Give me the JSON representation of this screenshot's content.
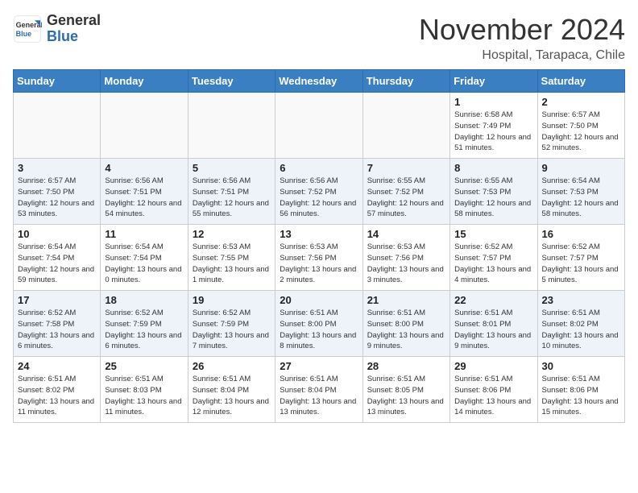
{
  "header": {
    "logo_general": "General",
    "logo_blue": "Blue",
    "month_title": "November 2024",
    "subtitle": "Hospital, Tarapaca, Chile"
  },
  "weekdays": [
    "Sunday",
    "Monday",
    "Tuesday",
    "Wednesday",
    "Thursday",
    "Friday",
    "Saturday"
  ],
  "weeks": [
    [
      {
        "day": "",
        "empty": true
      },
      {
        "day": "",
        "empty": true
      },
      {
        "day": "",
        "empty": true
      },
      {
        "day": "",
        "empty": true
      },
      {
        "day": "",
        "empty": true
      },
      {
        "day": "1",
        "sunrise": "6:58 AM",
        "sunset": "7:49 PM",
        "daylight": "12 hours and 51 minutes."
      },
      {
        "day": "2",
        "sunrise": "6:57 AM",
        "sunset": "7:50 PM",
        "daylight": "12 hours and 52 minutes."
      }
    ],
    [
      {
        "day": "3",
        "sunrise": "6:57 AM",
        "sunset": "7:50 PM",
        "daylight": "12 hours and 53 minutes."
      },
      {
        "day": "4",
        "sunrise": "6:56 AM",
        "sunset": "7:51 PM",
        "daylight": "12 hours and 54 minutes."
      },
      {
        "day": "5",
        "sunrise": "6:56 AM",
        "sunset": "7:51 PM",
        "daylight": "12 hours and 55 minutes."
      },
      {
        "day": "6",
        "sunrise": "6:56 AM",
        "sunset": "7:52 PM",
        "daylight": "12 hours and 56 minutes."
      },
      {
        "day": "7",
        "sunrise": "6:55 AM",
        "sunset": "7:52 PM",
        "daylight": "12 hours and 57 minutes."
      },
      {
        "day": "8",
        "sunrise": "6:55 AM",
        "sunset": "7:53 PM",
        "daylight": "12 hours and 58 minutes."
      },
      {
        "day": "9",
        "sunrise": "6:54 AM",
        "sunset": "7:53 PM",
        "daylight": "12 hours and 58 minutes."
      }
    ],
    [
      {
        "day": "10",
        "sunrise": "6:54 AM",
        "sunset": "7:54 PM",
        "daylight": "12 hours and 59 minutes."
      },
      {
        "day": "11",
        "sunrise": "6:54 AM",
        "sunset": "7:54 PM",
        "daylight": "13 hours and 0 minutes."
      },
      {
        "day": "12",
        "sunrise": "6:53 AM",
        "sunset": "7:55 PM",
        "daylight": "13 hours and 1 minute."
      },
      {
        "day": "13",
        "sunrise": "6:53 AM",
        "sunset": "7:56 PM",
        "daylight": "13 hours and 2 minutes."
      },
      {
        "day": "14",
        "sunrise": "6:53 AM",
        "sunset": "7:56 PM",
        "daylight": "13 hours and 3 minutes."
      },
      {
        "day": "15",
        "sunrise": "6:52 AM",
        "sunset": "7:57 PM",
        "daylight": "13 hours and 4 minutes."
      },
      {
        "day": "16",
        "sunrise": "6:52 AM",
        "sunset": "7:57 PM",
        "daylight": "13 hours and 5 minutes."
      }
    ],
    [
      {
        "day": "17",
        "sunrise": "6:52 AM",
        "sunset": "7:58 PM",
        "daylight": "13 hours and 6 minutes."
      },
      {
        "day": "18",
        "sunrise": "6:52 AM",
        "sunset": "7:59 PM",
        "daylight": "13 hours and 6 minutes."
      },
      {
        "day": "19",
        "sunrise": "6:52 AM",
        "sunset": "7:59 PM",
        "daylight": "13 hours and 7 minutes."
      },
      {
        "day": "20",
        "sunrise": "6:51 AM",
        "sunset": "8:00 PM",
        "daylight": "13 hours and 8 minutes."
      },
      {
        "day": "21",
        "sunrise": "6:51 AM",
        "sunset": "8:00 PM",
        "daylight": "13 hours and 9 minutes."
      },
      {
        "day": "22",
        "sunrise": "6:51 AM",
        "sunset": "8:01 PM",
        "daylight": "13 hours and 9 minutes."
      },
      {
        "day": "23",
        "sunrise": "6:51 AM",
        "sunset": "8:02 PM",
        "daylight": "13 hours and 10 minutes."
      }
    ],
    [
      {
        "day": "24",
        "sunrise": "6:51 AM",
        "sunset": "8:02 PM",
        "daylight": "13 hours and 11 minutes."
      },
      {
        "day": "25",
        "sunrise": "6:51 AM",
        "sunset": "8:03 PM",
        "daylight": "13 hours and 11 minutes."
      },
      {
        "day": "26",
        "sunrise": "6:51 AM",
        "sunset": "8:04 PM",
        "daylight": "13 hours and 12 minutes."
      },
      {
        "day": "27",
        "sunrise": "6:51 AM",
        "sunset": "8:04 PM",
        "daylight": "13 hours and 13 minutes."
      },
      {
        "day": "28",
        "sunrise": "6:51 AM",
        "sunset": "8:05 PM",
        "daylight": "13 hours and 13 minutes."
      },
      {
        "day": "29",
        "sunrise": "6:51 AM",
        "sunset": "8:06 PM",
        "daylight": "13 hours and 14 minutes."
      },
      {
        "day": "30",
        "sunrise": "6:51 AM",
        "sunset": "8:06 PM",
        "daylight": "13 hours and 15 minutes."
      }
    ]
  ]
}
